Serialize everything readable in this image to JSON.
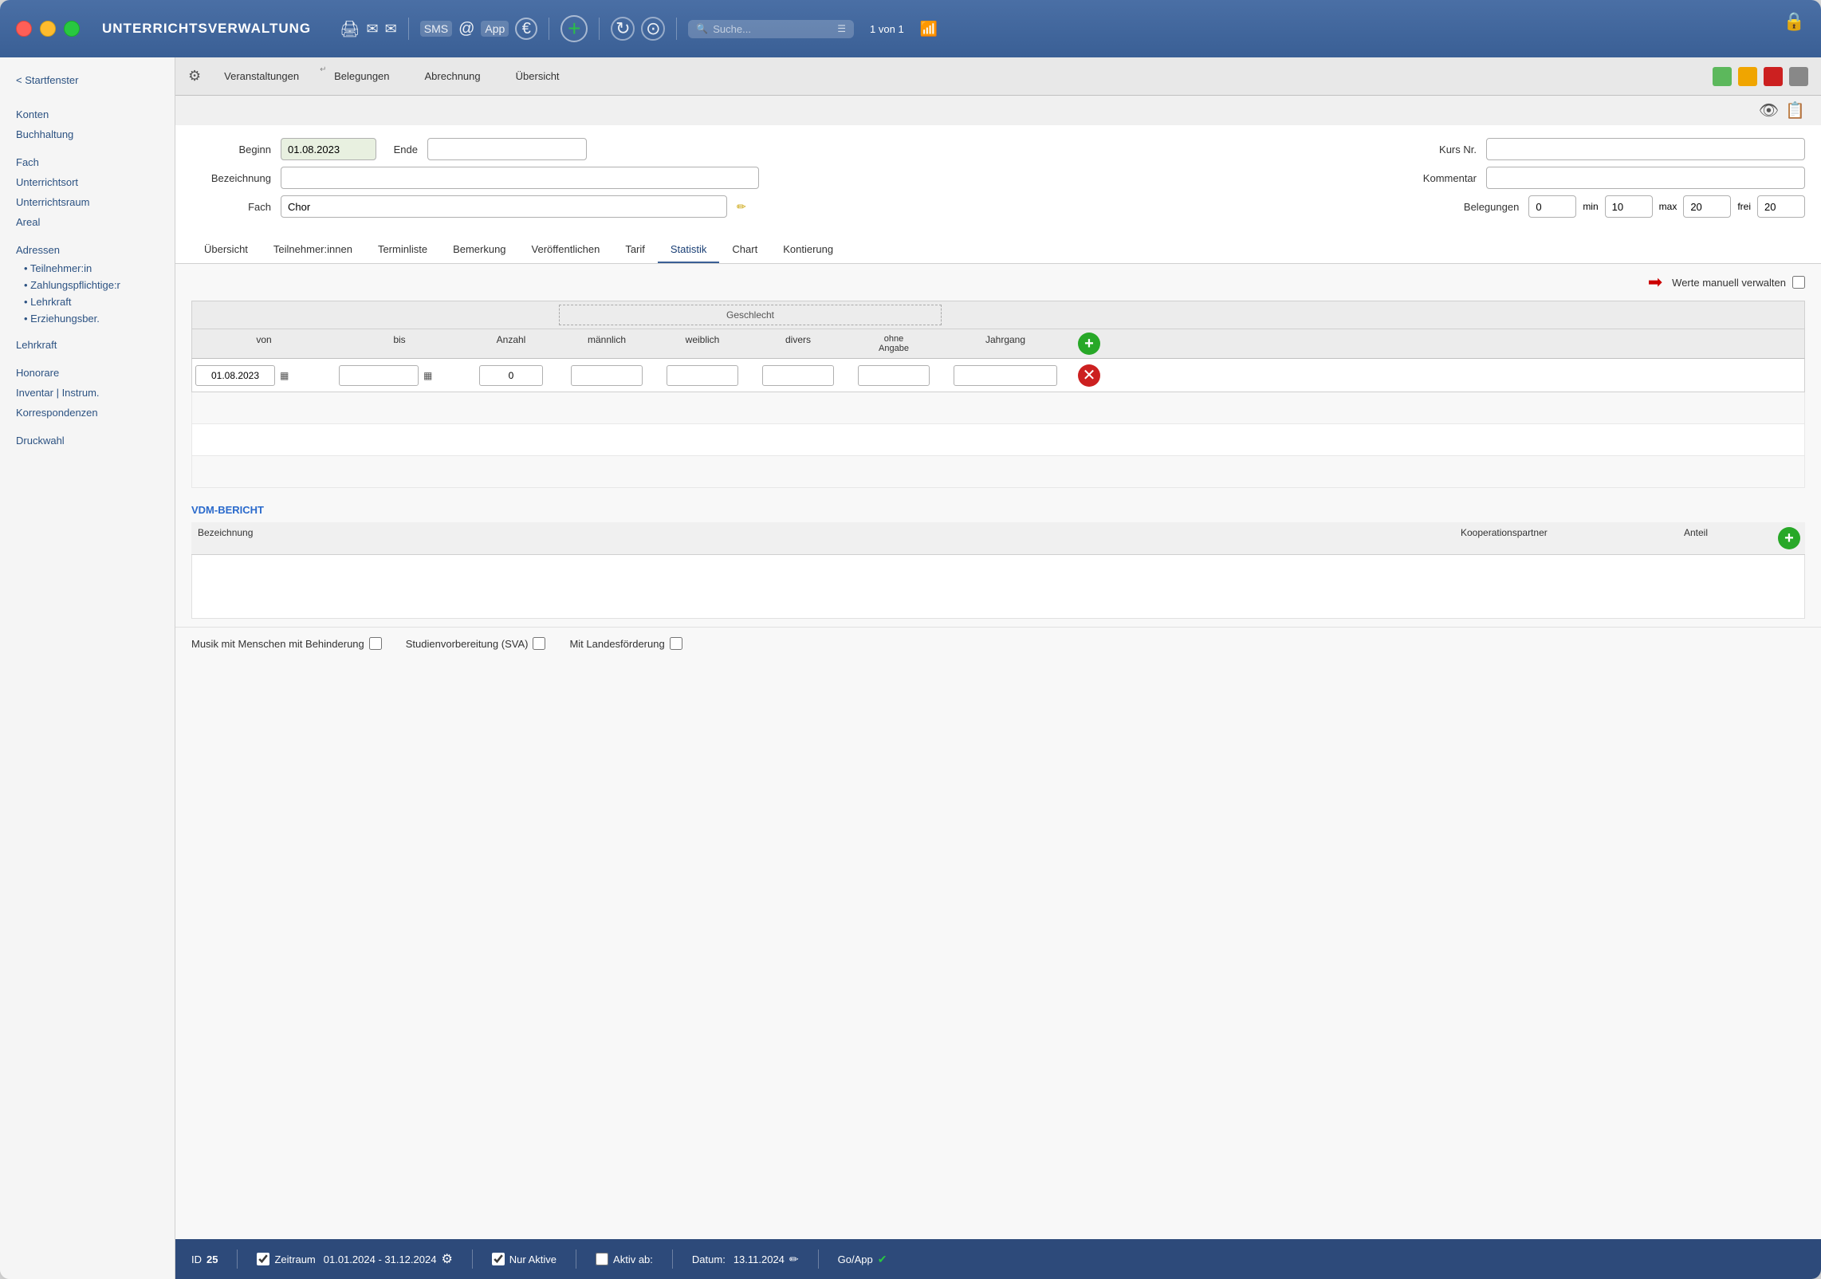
{
  "window": {
    "title": "UNTERRICHTSVERWALTUNG",
    "lock_icon": "🔒"
  },
  "titlebar": {
    "icon_print": "🖨",
    "icon_mail1": "✉",
    "icon_mail2": "✉",
    "icon_sms": "SMS",
    "icon_at": "@",
    "icon_app": "App",
    "icon_euro": "€",
    "icon_plus": "➕",
    "icon_refresh": "↺",
    "icon_search_settings": "⚙",
    "search_placeholder": "Suche...",
    "page_counter": "1 von 1",
    "signal_bars": "📶"
  },
  "tabs": {
    "main": [
      {
        "id": "veranstaltungen",
        "label": "Veranstaltungen",
        "active": false
      },
      {
        "id": "belegungen",
        "label": "Belegungen",
        "active": false
      },
      {
        "id": "abrechnung",
        "label": "Abrechnung",
        "active": false
      },
      {
        "id": "uebersicht",
        "label": "Übersicht",
        "active": false
      }
    ]
  },
  "form": {
    "beginn_label": "Beginn",
    "beginn_value": "01.08.2023",
    "ende_label": "Ende",
    "ende_value": "",
    "kurs_nr_label": "Kurs Nr.",
    "kurs_nr_value": "",
    "bezeichnung_label": "Bezeichnung",
    "bezeichnung_value": "",
    "kommentar_label": "Kommentar",
    "kommentar_value": "",
    "fach_label": "Fach",
    "fach_value": "Chor",
    "belegungen_label": "Belegungen",
    "belegungen_value": "0",
    "min_label": "min",
    "min_value": "10",
    "max_label": "max",
    "max_value": "20",
    "frei_label": "frei",
    "frei_value": "20"
  },
  "sub_tabs": [
    {
      "id": "uebersicht",
      "label": "Übersicht",
      "active": false
    },
    {
      "id": "teilnehmerinnen",
      "label": "Teilnehmer:innen",
      "active": false
    },
    {
      "id": "terminliste",
      "label": "Terminliste",
      "active": false
    },
    {
      "id": "bemerkung",
      "label": "Bemerkung",
      "active": false
    },
    {
      "id": "veroeffentlichen",
      "label": "Veröffentlichen",
      "active": false
    },
    {
      "id": "tarif",
      "label": "Tarif",
      "active": false
    },
    {
      "id": "statistik",
      "label": "Statistik",
      "active": true
    },
    {
      "id": "chart",
      "label": "Chart",
      "active": false
    },
    {
      "id": "kontierung",
      "label": "Kontierung",
      "active": false
    }
  ],
  "statistik": {
    "werte_label": "Werte manuell verwalten",
    "arrow_text": "→",
    "table": {
      "col_von": "von",
      "col_bis": "bis",
      "col_anzahl": "Anzahl",
      "col_geschlecht": "Geschlecht",
      "col_maennlich": "männlich",
      "col_weiblich": "weiblich",
      "col_divers": "divers",
      "col_ohne_angabe": "ohne\nAngabe",
      "col_jahrgang": "Jahrgang",
      "rows": [
        {
          "von": "01.08.2023",
          "bis": "",
          "anzahl": "0",
          "maennlich": "",
          "weiblich": "",
          "divers": "",
          "ohne_angabe": "",
          "jahrgang": ""
        }
      ]
    }
  },
  "vdm": {
    "title": "VDM-BERICHT",
    "col_bezeichnung": "Bezeichnung",
    "col_kooperationspartner": "Kooperationspartner",
    "col_anteil": "Anteil",
    "add_icon": "+"
  },
  "bottom_checks": {
    "musik_label": "Musik mit Menschen mit Behinderung",
    "svs_label": "Studienvorbereitung (SVA)",
    "landesfoerderung_label": "Mit Landesförderung"
  },
  "status_bar": {
    "id_label": "ID",
    "id_value": "25",
    "zeitraum_label": "Zeitraum",
    "zeitraum_value": "01.01.2024 - 31.12.2024",
    "nur_aktive_label": "Nur Aktive",
    "aktiv_ab_label": "Aktiv ab:",
    "datum_label": "Datum:",
    "datum_value": "13.11.2024",
    "go_app_label": "Go/App"
  },
  "sidebar": {
    "back": "< Startfenster",
    "items": [
      {
        "id": "konten",
        "label": "Konten"
      },
      {
        "id": "buchhaltung",
        "label": "Buchhaltung"
      },
      {
        "id": "fach",
        "label": "Fach"
      },
      {
        "id": "unterrichtsort",
        "label": "Unterrichtsort"
      },
      {
        "id": "unterrichtsraum",
        "label": "Unterrichtsraum"
      },
      {
        "id": "areal",
        "label": "Areal"
      },
      {
        "id": "adressen",
        "label": "Adressen"
      },
      {
        "id": "teilnehmerin",
        "label": "• Teilnehmer:in"
      },
      {
        "id": "zahlungspflichtige",
        "label": "• Zahlungspflichtige:r"
      },
      {
        "id": "lehrkraft_sub",
        "label": "• Lehrkraft"
      },
      {
        "id": "erziehungsber",
        "label": "• Erziehungsber."
      },
      {
        "id": "lehrkraft",
        "label": "Lehrkraft"
      },
      {
        "id": "honorare",
        "label": "Honorare"
      },
      {
        "id": "inventar",
        "label": "Inventar | Instrum."
      },
      {
        "id": "korrespondenzen",
        "label": "Korrespondenzen"
      },
      {
        "id": "druckwahl",
        "label": "Druckwahl"
      }
    ]
  },
  "colors": {
    "accent_blue": "#2d4a7a",
    "header_blue": "#3a5f95",
    "link_blue": "#2a6acc",
    "green": "#28a828",
    "red": "#cc2020",
    "green_status": "#5cb85c",
    "yellow_status": "#f0a500",
    "red_status": "#cc2020"
  },
  "status_dots": [
    "#5cb85c",
    "#f0a500",
    "#cc2020",
    "#888888"
  ]
}
